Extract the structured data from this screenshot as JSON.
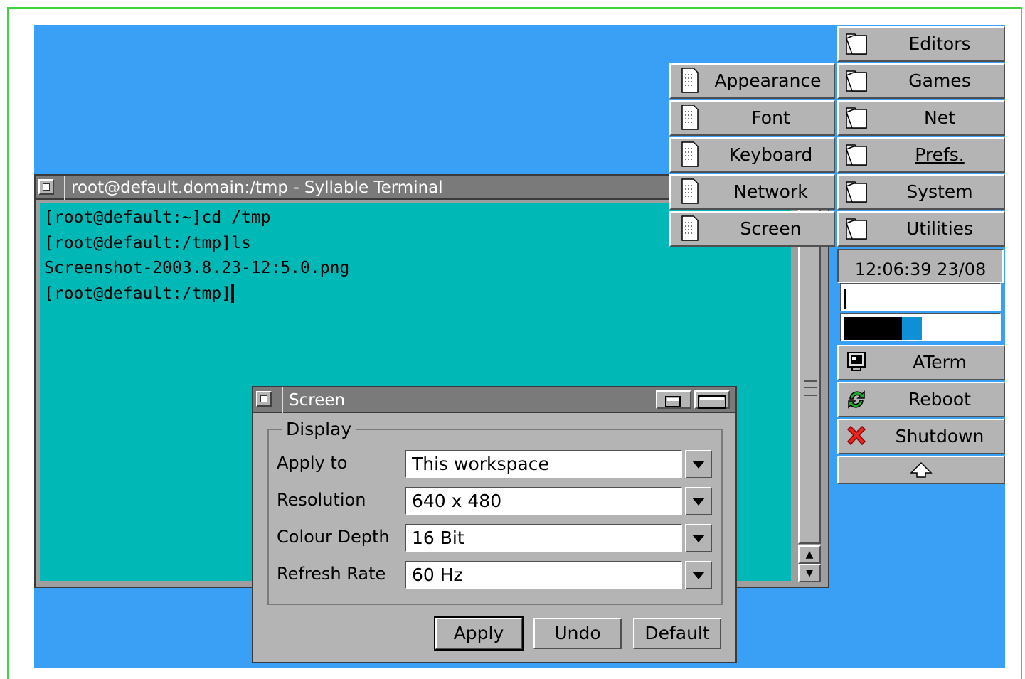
{
  "terminal": {
    "title": "root@default.domain:/tmp - Syllable Terminal",
    "lines": [
      "[root@default:~]cd /tmp",
      "[root@default:/tmp]ls",
      "Screenshot-2003.8.23-12:5.0.png",
      "[root@default:/tmp]"
    ]
  },
  "dialog": {
    "title": "Screen",
    "group_label": "Display",
    "rows": [
      {
        "label": "Apply to",
        "value": "This workspace"
      },
      {
        "label": "Resolution",
        "value": "640 x 480"
      },
      {
        "label": "Colour Depth",
        "value": "16 Bit"
      },
      {
        "label": "Refresh Rate",
        "value": "60 Hz"
      }
    ],
    "buttons": {
      "apply": "Apply",
      "undo": "Undo",
      "default": "Default"
    }
  },
  "submenu": {
    "items": [
      "Appearance",
      "Font",
      "Keyboard",
      "Network",
      "Screen"
    ]
  },
  "dock": {
    "folders": [
      "Editors",
      "Games",
      "Net",
      "Prefs.",
      "System",
      "Utilities"
    ],
    "clock": "12:06:39 23/08",
    "memory_meter": {
      "black_fraction": 0.37,
      "blue_fraction": 0.13
    },
    "launchers": [
      {
        "label": "ATerm",
        "icon": "terminal-icon"
      },
      {
        "label": "Reboot",
        "icon": "reboot-icon"
      },
      {
        "label": "Shutdown",
        "icon": "shutdown-icon"
      }
    ],
    "collapse_icon": "up-arrow-icon"
  },
  "colors": {
    "desktop": "#3aa0f5",
    "terminal_bg": "#00b9b7",
    "frame": "#3fd43f"
  }
}
